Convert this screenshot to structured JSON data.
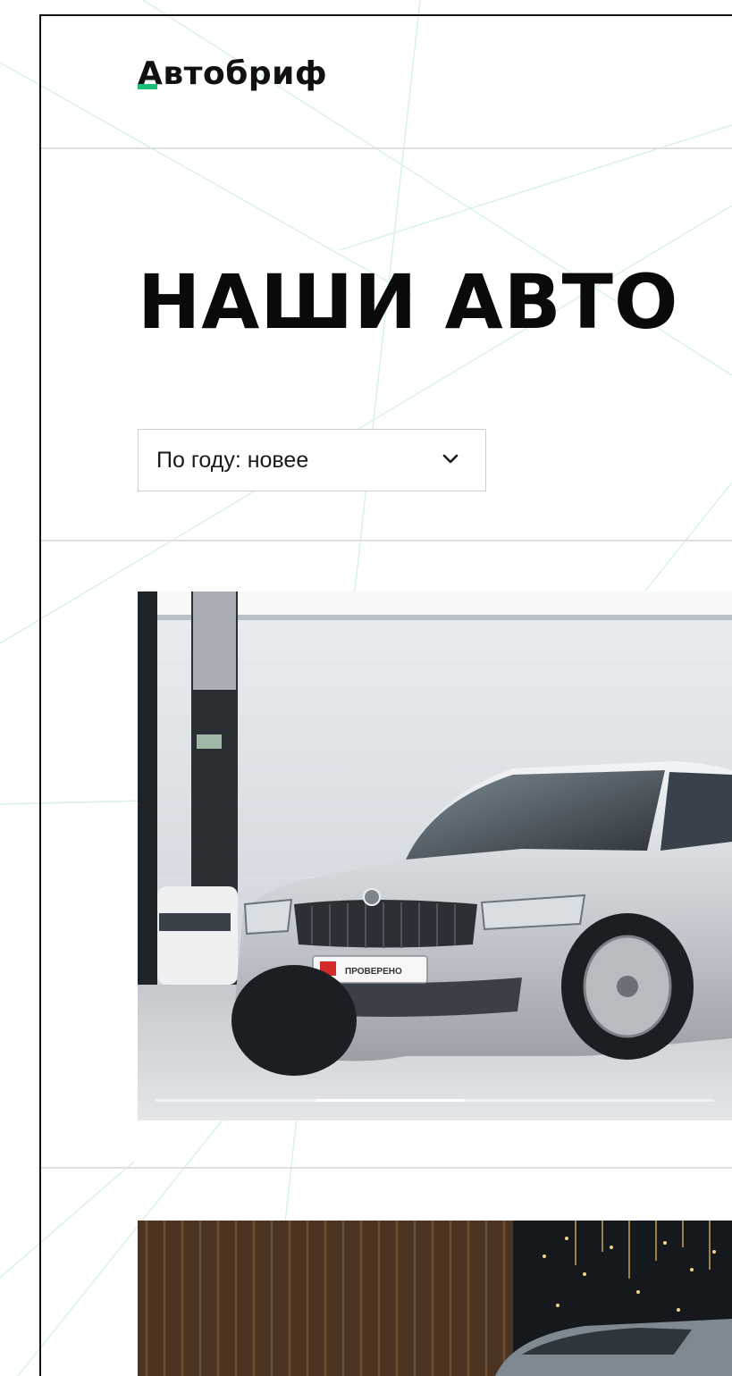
{
  "header": {
    "logo_text": "Автобриф"
  },
  "main": {
    "title": "НАШИ АВТО",
    "sort": {
      "selected": "По году: новее",
      "icon": "chevron-down-icon"
    },
    "listings": [
      {
        "photo_subject": "car-photo",
        "badge_text": "ПРОВЕРЕНО",
        "slide_indicator_active": 0.33
      },
      {
        "photo_subject": "car-photo"
      }
    ]
  },
  "colors": {
    "accent": "#1bbf7a",
    "text": "#0a0a0a",
    "divider": "#e0e0e0",
    "frame": "#141414"
  }
}
